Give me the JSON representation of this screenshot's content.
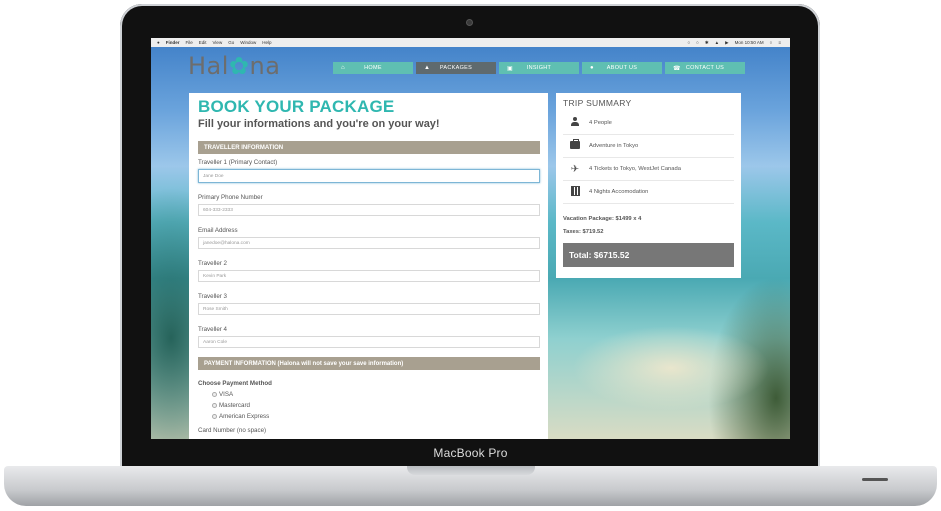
{
  "device": {
    "label": "MacBook Pro"
  },
  "menubar": {
    "app": "Finder",
    "items": [
      "File",
      "Edit",
      "View",
      "Go",
      "Window",
      "Help"
    ],
    "clock": "Mon 10:50 AM"
  },
  "site": {
    "logo_left": "Hal",
    "logo_right": "na",
    "nav": [
      {
        "label": "HOME",
        "icon": "home-icon"
      },
      {
        "label": "PACKAGES",
        "icon": "packages-icon"
      },
      {
        "label": "INSIGHT",
        "icon": "insight-icon"
      },
      {
        "label": "ABOUT US",
        "icon": "about-icon"
      },
      {
        "label": "CONTACT US",
        "icon": "phone-icon"
      }
    ],
    "active_nav": "PACKAGES",
    "accent_color": "#2fb7b0"
  },
  "booking": {
    "title": "BOOK YOUR PACKAGE",
    "subtitle": "Fill your informations and you're on your way!",
    "traveller_section": "TRAVELLER INFORMATION",
    "fields": [
      {
        "label": "Traveller 1 (Primary Contact)",
        "value": "Jane Doe"
      },
      {
        "label": "Primary Phone Number",
        "value": "604-333-2333"
      },
      {
        "label": "Email Address",
        "value": "janedoe@halona.com"
      },
      {
        "label": "Traveller 2",
        "value": "Kevin Park"
      },
      {
        "label": "Traveller 3",
        "value": "Rose Smith"
      },
      {
        "label": "Traveller 4",
        "value": "Aaron Cole"
      }
    ],
    "payment_section": "PAYMENT INFORMATION (Halona will not save your save information)",
    "payment_method_label": "Choose Payment Method",
    "payment_options": [
      "VISA",
      "Mastercard",
      "American Express"
    ],
    "card_number_label": "Card Number (no space)"
  },
  "summary": {
    "title": "TRIP SUMMARY",
    "rows": [
      {
        "icon": "person-icon",
        "text": "4 People"
      },
      {
        "icon": "luggage-icon",
        "text": "Adventure in Tokyo"
      },
      {
        "icon": "airplane-icon",
        "text": "4 Tickets to Tokyo, WestJet Canada"
      },
      {
        "icon": "hotel-icon",
        "text": "4 Nights Accomodation"
      }
    ],
    "package_line": "Vacation Package: $1499 x 4",
    "taxes_line": "Taxes: $719.52",
    "total": "Total: $6715.52"
  }
}
